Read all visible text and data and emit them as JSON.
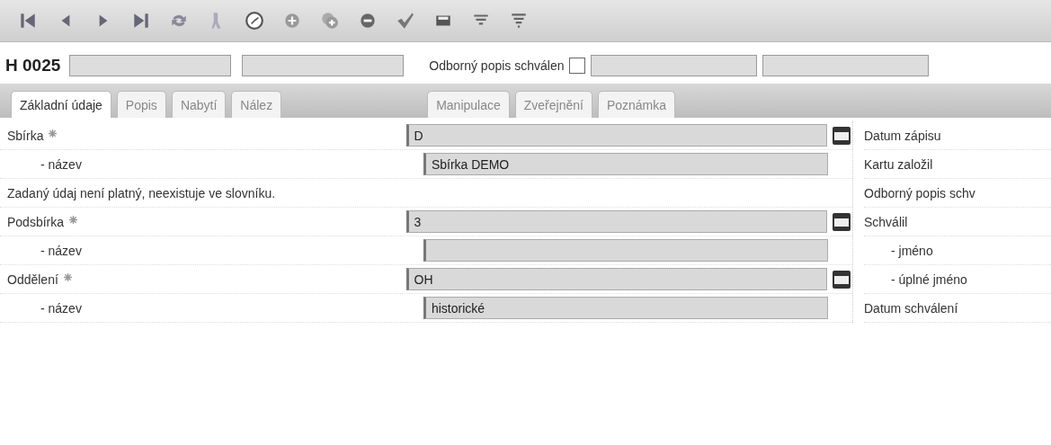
{
  "header": {
    "record_id": "H 0025",
    "approval_label": "Odborný popis schválen",
    "approval_checked": false
  },
  "tabs": [
    {
      "label": "Základní údaje",
      "selected": true
    },
    {
      "label": "Popis",
      "selected": false
    },
    {
      "label": "Nabytí",
      "selected": false
    },
    {
      "label": "Nález",
      "selected": false
    },
    {
      "label": "Manipulace",
      "selected": false
    },
    {
      "label": "Zveřejnění",
      "selected": false
    },
    {
      "label": "Poznámka",
      "selected": false
    }
  ],
  "form": [
    {
      "kind": "field",
      "label": "Sbírka",
      "required": true,
      "value": "D",
      "picker": true
    },
    {
      "kind": "subfield",
      "label": "- název",
      "required": false,
      "value": "Sbírka DEMO",
      "picker": false
    },
    {
      "kind": "message",
      "text": "Zadaný údaj není platný, neexistuje ve slovníku."
    },
    {
      "kind": "field",
      "label": "Podsbírka",
      "required": true,
      "value": "3",
      "picker": true
    },
    {
      "kind": "subfield",
      "label": "- název",
      "required": false,
      "picker": false
    },
    {
      "kind": "field",
      "label": "Oddělení",
      "required": true,
      "value": "OH",
      "picker": true
    },
    {
      "kind": "subfield",
      "label": "- název",
      "required": false,
      "value": "historické",
      "picker": false
    }
  ],
  "side": [
    {
      "kind": "label",
      "label": "Datum zápisu"
    },
    {
      "kind": "label",
      "label": "Kartu založil"
    },
    {
      "kind": "label",
      "label": "Odborný popis schv"
    },
    {
      "kind": "label",
      "label": "Schválil"
    },
    {
      "kind": "sublabel",
      "label": "- jméno"
    },
    {
      "kind": "sublabel",
      "label": "- úplné jméno"
    },
    {
      "kind": "label",
      "label": "Datum schválení"
    }
  ]
}
